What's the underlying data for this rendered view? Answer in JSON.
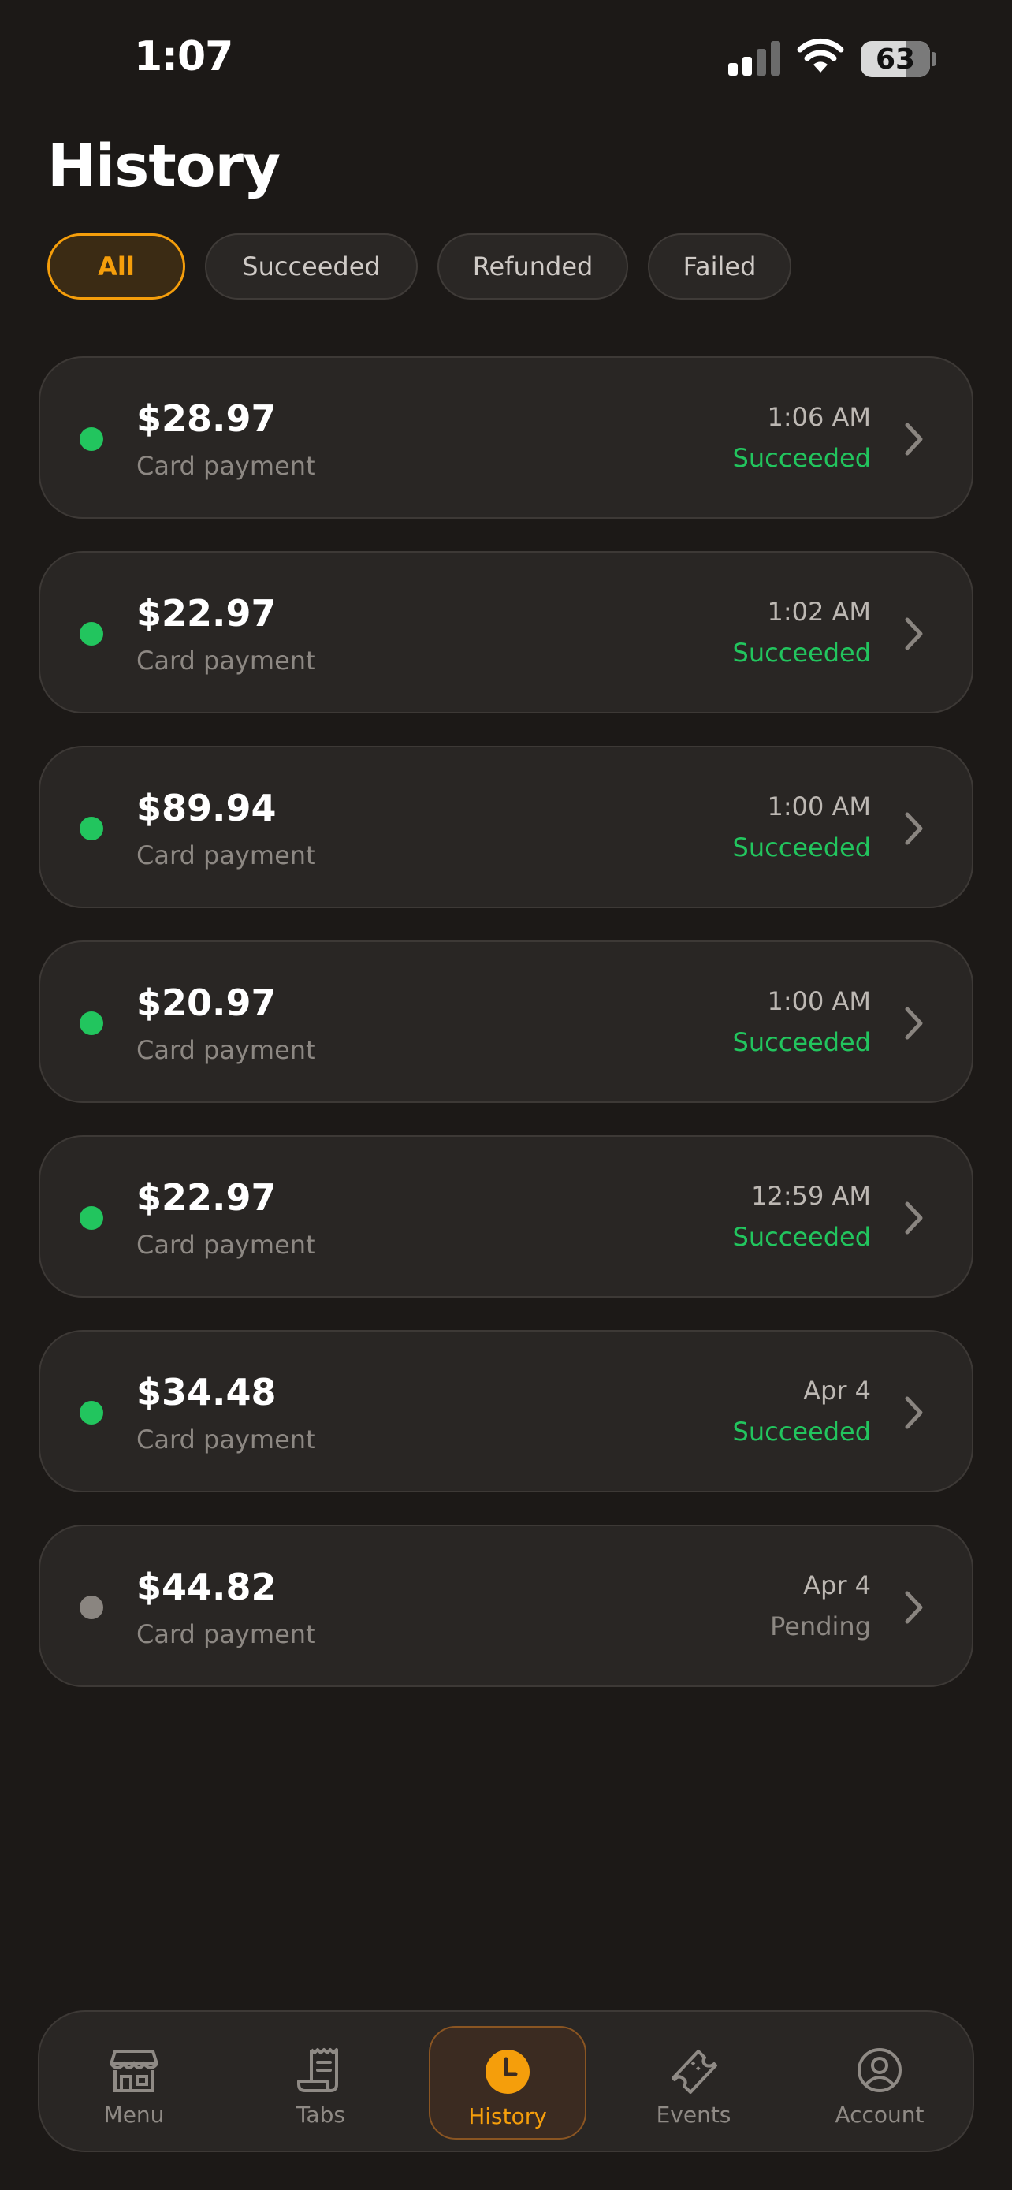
{
  "status_bar": {
    "time": "1:07",
    "battery": "63"
  },
  "page": {
    "title": "History"
  },
  "filters": [
    {
      "label": "All",
      "active": true
    },
    {
      "label": "Succeeded",
      "active": false
    },
    {
      "label": "Refunded",
      "active": false
    },
    {
      "label": "Failed",
      "active": false
    }
  ],
  "transactions": [
    {
      "amount": "$28.97",
      "method": "Card payment",
      "time": "1:06 AM",
      "status": "Succeeded"
    },
    {
      "amount": "$22.97",
      "method": "Card payment",
      "time": "1:02 AM",
      "status": "Succeeded"
    },
    {
      "amount": "$89.94",
      "method": "Card payment",
      "time": "1:00 AM",
      "status": "Succeeded"
    },
    {
      "amount": "$20.97",
      "method": "Card payment",
      "time": "1:00 AM",
      "status": "Succeeded"
    },
    {
      "amount": "$22.97",
      "method": "Card payment",
      "time": "12:59 AM",
      "status": "Succeeded"
    },
    {
      "amount": "$34.48",
      "method": "Card payment",
      "time": "Apr 4",
      "status": "Succeeded"
    },
    {
      "amount": "$44.82",
      "method": "Card payment",
      "time": "Apr 4",
      "status": "Pending"
    }
  ],
  "tabbar": [
    {
      "label": "Menu",
      "icon": "storefront-icon"
    },
    {
      "label": "Tabs",
      "icon": "receipt-icon"
    },
    {
      "label": "History",
      "icon": "clock-icon",
      "active": true
    },
    {
      "label": "Events",
      "icon": "ticket-icon"
    },
    {
      "label": "Account",
      "icon": "user-circle-icon"
    }
  ],
  "colors": {
    "accent": "#f59e0b",
    "success": "#22c55e",
    "pending": "#8a8580",
    "background": "#1c1917"
  }
}
